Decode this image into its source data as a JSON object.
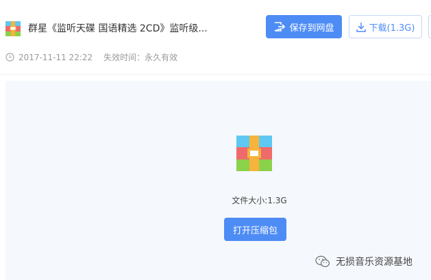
{
  "file": {
    "title": "群星《监听天碟 国语精选 2CD》监听级...",
    "date": "2017-11-11 22:22",
    "expire_label": "失效时间：",
    "expire_value": "永久有效"
  },
  "actions": {
    "save_label": "保存到网盘",
    "download_label": "下载(1.3G)"
  },
  "preview": {
    "size_label": "文件大小:1.3G",
    "open_label": "打开压缩包"
  },
  "watermark": {
    "text": "无损音乐资源基地"
  },
  "colors": {
    "accent": "#4e8cf5",
    "preview_bg": "#f5f8fc",
    "zip_top": "#5ec8f2",
    "zip_mid": "#ef6a6a",
    "zip_bottom": "#8cd14a",
    "zip_strap": "#f6b43c"
  }
}
